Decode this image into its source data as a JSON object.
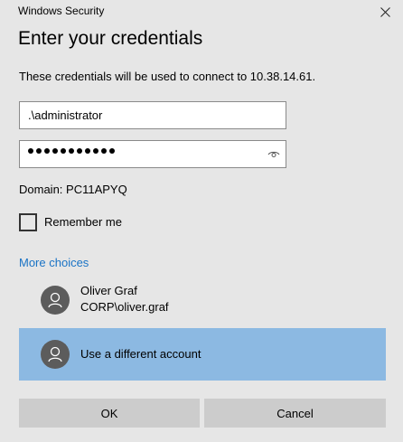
{
  "window": {
    "title": "Windows Security",
    "close_icon": "close-icon"
  },
  "heading": "Enter your credentials",
  "subtitle": "These credentials will be used to connect to 10.38.14.61.",
  "username": {
    "value": ".\\administrator"
  },
  "password": {
    "masked_length": 11,
    "reveal_icon": "eye-icon"
  },
  "domain_text": "Domain: PC11APYQ",
  "remember_me": {
    "label": "Remember me",
    "checked": false
  },
  "more_choices_label": "More choices",
  "accounts": [
    {
      "name": "Oliver Graf",
      "sub": "CORP\\oliver.graf",
      "icon": "user-avatar-icon",
      "selected": false
    },
    {
      "name": "Use a different account",
      "icon": "user-avatar-icon",
      "selected": true
    }
  ],
  "buttons": {
    "ok_label": "OK",
    "cancel_label": "Cancel"
  },
  "colors": {
    "background": "#e6e6e6",
    "link": "#1a73c5",
    "selected_row": "#8cb9e2",
    "button": "#cccccc",
    "avatar": "#5c5c5c"
  }
}
